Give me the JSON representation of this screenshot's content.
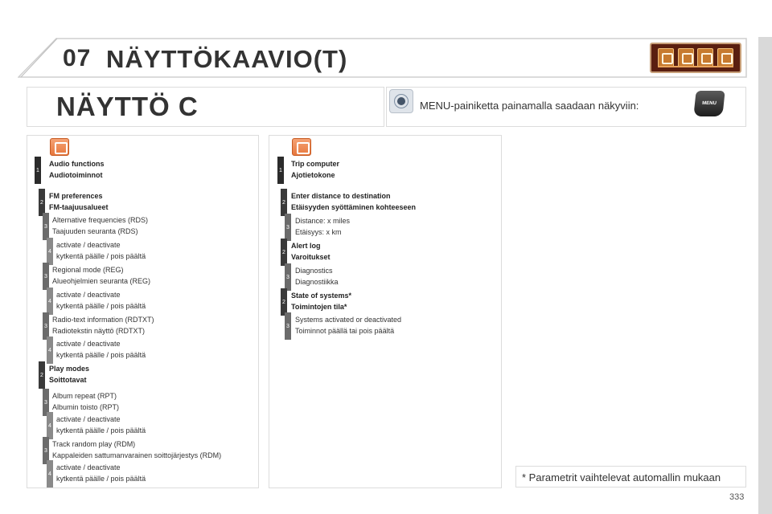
{
  "header": {
    "chapter": "07",
    "title": "NÄYTTÖKAAVIO(T)"
  },
  "section": {
    "title": "NÄYTTÖ C",
    "info": "MENU-painiketta painamalla saadaan näkyviin:",
    "menu_button_label": "MENU"
  },
  "left_panel": {
    "items": [
      {
        "level": "1",
        "lines": [
          "Audio functions",
          "Audiotoiminnot"
        ],
        "bold": true
      },
      {
        "level": "2",
        "lines": [
          "FM preferences",
          "FM-taajuusalueet"
        ],
        "bold": true
      },
      {
        "level": "3",
        "lines": [
          "Alternative frequencies (RDS)",
          "Taajuuden seuranta (RDS)"
        ],
        "bold": false
      },
      {
        "level": "4",
        "lines": [
          "activate / deactivate",
          "kytkentä päälle / pois päältä"
        ],
        "bold": false
      },
      {
        "level": "3",
        "lines": [
          "Regional mode (REG)",
          "Alueohjelmien seuranta (REG)"
        ],
        "bold": false
      },
      {
        "level": "4",
        "lines": [
          "activate / deactivate",
          "kytkentä päälle / pois päältä"
        ],
        "bold": false
      },
      {
        "level": "3",
        "lines": [
          "Radio-text information (RDTXT)",
          "Radiotekstin näyttö (RDTXT)"
        ],
        "bold": false
      },
      {
        "level": "4",
        "lines": [
          "activate / deactivate",
          "kytkentä päälle / pois päältä"
        ],
        "bold": false
      },
      {
        "level": "2",
        "lines": [
          "Play modes",
          "Soittotavat"
        ],
        "bold": true
      },
      {
        "level": "3",
        "lines": [
          "Album repeat (RPT)",
          "Albumin toisto (RPT)"
        ],
        "bold": false
      },
      {
        "level": "4",
        "lines": [
          "activate / deactivate",
          "kytkentä päälle / pois päältä"
        ],
        "bold": false
      },
      {
        "level": "3",
        "lines": [
          "Track random play (RDM)",
          "Kappaleiden sattumanvarainen soittojärjestys (RDM)"
        ],
        "bold": false
      },
      {
        "level": "4",
        "lines": [
          "activate / deactivate",
          "kytkentä päälle / pois päältä"
        ],
        "bold": false
      }
    ]
  },
  "right_panel": {
    "items": [
      {
        "level": "1",
        "lines": [
          "Trip computer",
          "Ajotietokone"
        ],
        "bold": true
      },
      {
        "level": "2",
        "lines": [
          "Enter distance to destination",
          "Etäisyyden syöttäminen kohteeseen"
        ],
        "bold": true
      },
      {
        "level": "3",
        "lines": [
          "Distance: x miles",
          "Etäisyys: x km"
        ],
        "bold": false
      },
      {
        "level": "2",
        "lines": [
          "Alert log",
          "Varoitukset"
        ],
        "bold": true
      },
      {
        "level": "3",
        "lines": [
          "Diagnostics",
          "Diagnostiikka"
        ],
        "bold": false
      },
      {
        "level": "2",
        "lines": [
          "State of systems*",
          "Toimintojen tila*"
        ],
        "bold": true
      },
      {
        "level": "3",
        "lines": [
          "Systems activated or deactivated",
          "Toiminnot päällä tai pois päältä"
        ],
        "bold": false
      }
    ]
  },
  "footnote": "* Parametrit vaihtelevat automallin mukaan",
  "page_number": "333",
  "icons": {
    "header_banner": [
      "audio-icon",
      "trip-icon",
      "settings-icon",
      "fuel-icon"
    ],
    "left_panel": "audio-icon",
    "right_panel": "fuel-icon",
    "info": "bulb-icon"
  }
}
